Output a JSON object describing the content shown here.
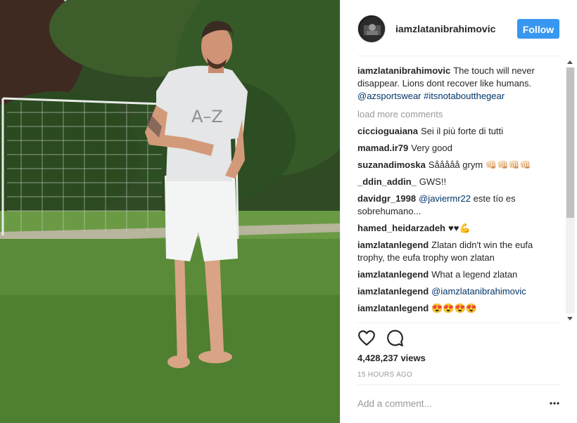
{
  "post": {
    "username": "iamzlatanibrahimovic",
    "follow_label": "Follow",
    "caption": {
      "user": "iamzlatanibrahimovic",
      "text": "The touch will never disappear. Lions dont recover like humans.",
      "mention": "@azsportswear",
      "hashtag": "#itsnotaboutthegear"
    },
    "load_more": "load more comments",
    "comments": [
      {
        "user": "ciccioguaiana",
        "text": "Sei il più forte di tutti"
      },
      {
        "user": "mamad.ir79",
        "text": "Very good"
      },
      {
        "user": "suzanadimoska",
        "text": "Sååååå grym 👊🏻👊🏻👊🏻👊🏻"
      },
      {
        "user": "_ddin_addin_",
        "text": "GWS!!"
      },
      {
        "user": "davidgr_1998",
        "mention": "@javiermr22",
        "text": "este tío es sobrehumano..."
      },
      {
        "user": "hamed_heidarzadeh",
        "text": "♥♥💪"
      },
      {
        "user": "iamzlatanlegend",
        "text": "Zlatan didn't win the eufa trophy, the eufa trophy won zlatan"
      },
      {
        "user": "iamzlatanlegend",
        "text": "What a legend zlatan"
      },
      {
        "user": "iamzlatanlegend",
        "mention": "@iamzlatanibrahimovic",
        "text": ""
      },
      {
        "user": "iamzlatanlegend",
        "text": "😍😍😍😍"
      }
    ],
    "views": "4,428,237 views",
    "time": "15 HOURS AGO",
    "comment_placeholder": "Add a comment...",
    "shirt_text": "A–Z",
    "icons": {
      "like": "heart-icon",
      "comment": "comment-bubble-icon",
      "more": "more-options-icon"
    },
    "colors": {
      "follow": "#3897f0",
      "link": "#003569",
      "muted": "#999999"
    }
  }
}
